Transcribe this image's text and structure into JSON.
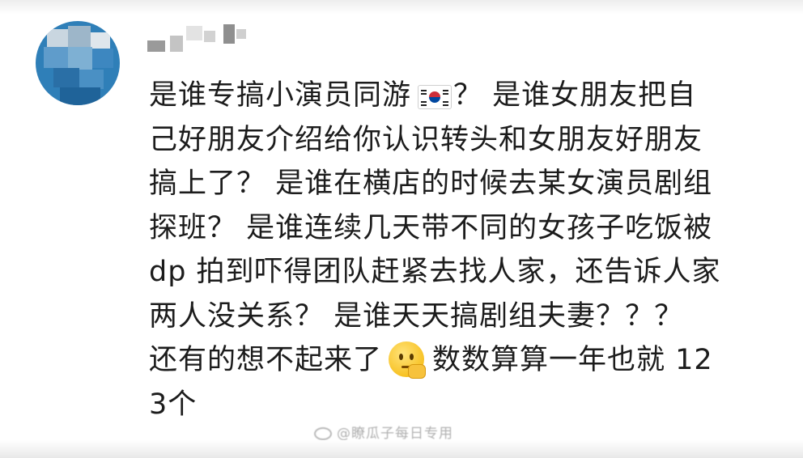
{
  "comment": {
    "lines": [
      {
        "segments": [
          "是谁专搞小演员同游",
          "？ 是谁女朋友把自"
        ]
      },
      {
        "segments": [
          "己好朋友介绍给你认识转头和女朋友好朋友"
        ]
      },
      {
        "segments": [
          "搞上了？ 是谁在横店的时候去某女演员剧组"
        ]
      },
      {
        "segments": [
          "探班？ 是谁连续几天带不同的女孩子吃饭被"
        ]
      },
      {
        "segments": [
          "dp 拍到吓得团队赶紧去找人家，还告诉人家"
        ]
      },
      {
        "segments": [
          "两人没关系？ 是谁天天搞剧组夫妻？？？"
        ]
      },
      {
        "segments": [
          "还有的想不起来了",
          "数数算算一年也就 12"
        ]
      },
      {
        "segments": [
          "3个"
        ]
      }
    ],
    "emojis": {
      "line1": "south-korea-flag-icon",
      "line7": "thinking-face-icon"
    }
  },
  "watermark": {
    "text": "@瞭瓜子每日专用"
  }
}
